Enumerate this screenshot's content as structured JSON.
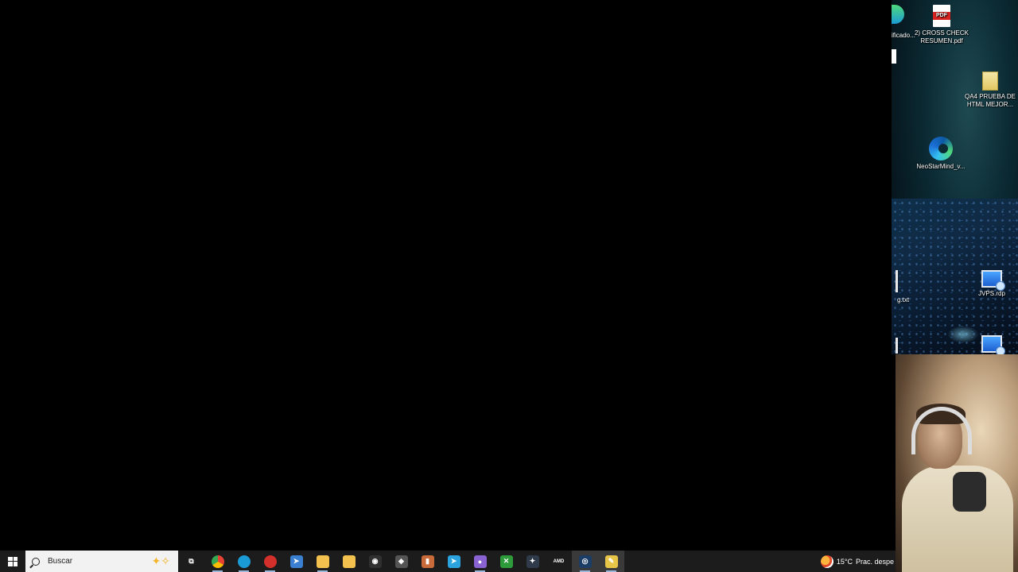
{
  "desktop": {
    "icons": [
      {
        "label_line1": "2) CROSS CHECK",
        "label_line2": "RESUMEN.pdf",
        "icon": "pdf-icon"
      },
      {
        "label_line1": "QA4 PRUEBA DE",
        "label_line2": "HTML MEJOR...",
        "icon": "folder-icon"
      },
      {
        "label_line1": "NeoStarMind_v...",
        "label_line2": "",
        "icon": "edge-icon"
      },
      {
        "label_line1": "JVPS.rdp",
        "label_line2": "",
        "icon": "remote-desktop-icon"
      }
    ],
    "cut_labels": {
      "top_left": "ificado...",
      "mid_left": "g.txt"
    }
  },
  "taskbar": {
    "search_placeholder": "Buscar",
    "apps": [
      {
        "name": "task-view",
        "glyph": "⧉",
        "color": "#1c1c1c"
      },
      {
        "name": "chrome",
        "glyph": "",
        "color": "#e94235"
      },
      {
        "name": "edge",
        "glyph": "",
        "color": "#1b9bd6"
      },
      {
        "name": "screen-recorder",
        "glyph": "",
        "color": "#d3302b"
      },
      {
        "name": "pointer-app",
        "glyph": "➤",
        "color": "#3b7fd0"
      },
      {
        "name": "file-explorer",
        "glyph": "",
        "color": "#f2c14e"
      },
      {
        "name": "store",
        "glyph": "",
        "color": "#f2c14e"
      },
      {
        "name": "obs",
        "glyph": "◉",
        "color": "#303030"
      },
      {
        "name": "unity",
        "glyph": "◆",
        "color": "#555555"
      },
      {
        "name": "office-app",
        "glyph": "▮",
        "color": "#c96a3a"
      },
      {
        "name": "telegram",
        "glyph": "➤",
        "color": "#2aa3df"
      },
      {
        "name": "chat-app",
        "glyph": "●",
        "color": "#8a63d2"
      },
      {
        "name": "xbox",
        "glyph": "✕",
        "color": "#2e9b3a"
      },
      {
        "name": "davinci",
        "glyph": "✦",
        "color": "#2f3a4a"
      },
      {
        "name": "amd-software",
        "glyph": "AMD",
        "color": "#1c1c1c"
      },
      {
        "name": "steam",
        "glyph": "◎",
        "color": "#1b3d66"
      },
      {
        "name": "paint-app",
        "glyph": "✎",
        "color": "#e6c547"
      }
    ],
    "weather_temp": "15°C",
    "weather_text": "Prac. despe"
  }
}
